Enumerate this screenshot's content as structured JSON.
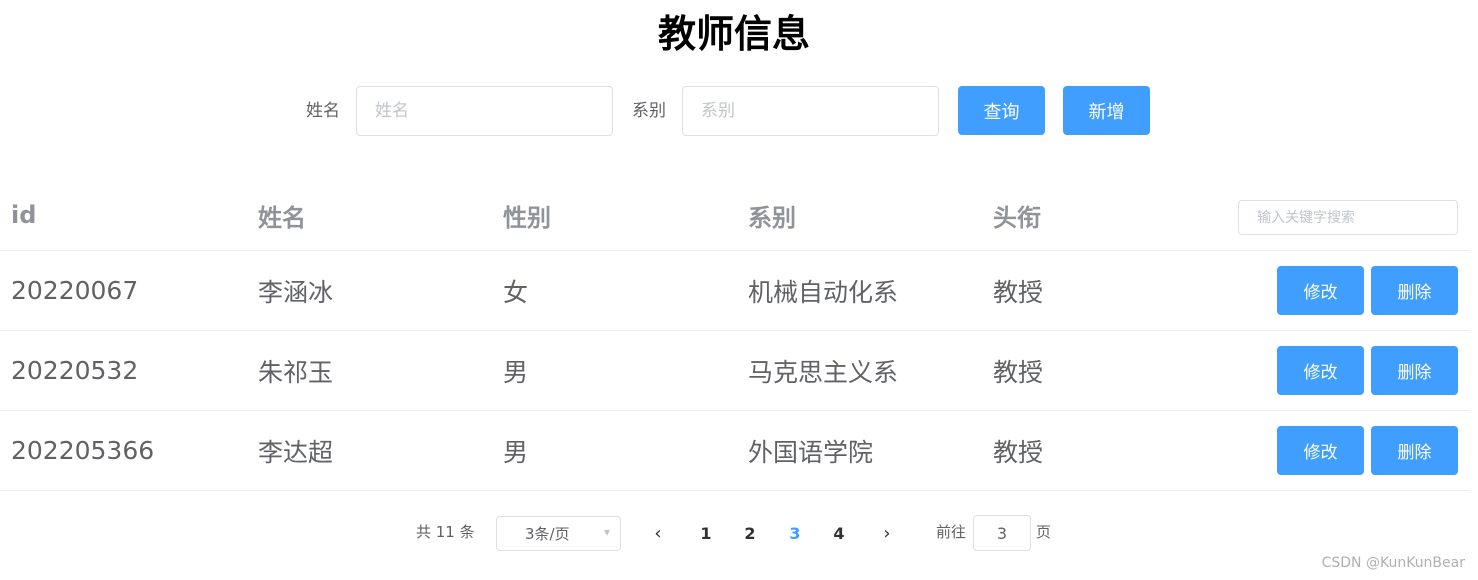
{
  "title": "教师信息",
  "search": {
    "name_label": "姓名",
    "name_placeholder": "姓名",
    "dept_label": "系别",
    "dept_placeholder": "系别",
    "query_button": "查询",
    "add_button": "新增"
  },
  "table": {
    "headers": {
      "id": "id",
      "name": "姓名",
      "gender": "性别",
      "dept": "系别",
      "title": "头衔"
    },
    "keyword_placeholder": "输入关键字搜索",
    "edit_label": "修改",
    "delete_label": "删除",
    "rows": [
      {
        "id": "20220067",
        "name": "李涵冰",
        "gender": "女",
        "dept": "机械自动化系",
        "title": "教授"
      },
      {
        "id": "20220532",
        "name": "朱祁玉",
        "gender": "男",
        "dept": "马克思主义系",
        "title": "教授"
      },
      {
        "id": "202205366",
        "name": "李达超",
        "gender": "男",
        "dept": "外国语学院",
        "title": "教授"
      }
    ]
  },
  "pagination": {
    "total_text": "共 11 条",
    "page_size": "3条/页",
    "pages": [
      "1",
      "2",
      "3",
      "4"
    ],
    "current_page": "3",
    "goto_label": "前往",
    "goto_value": "3",
    "page_suffix": "页"
  },
  "watermark": "CSDN @KunKunBear",
  "colors": {
    "primary": "#409eff",
    "border": "#dcdfe6",
    "text": "#606266"
  }
}
